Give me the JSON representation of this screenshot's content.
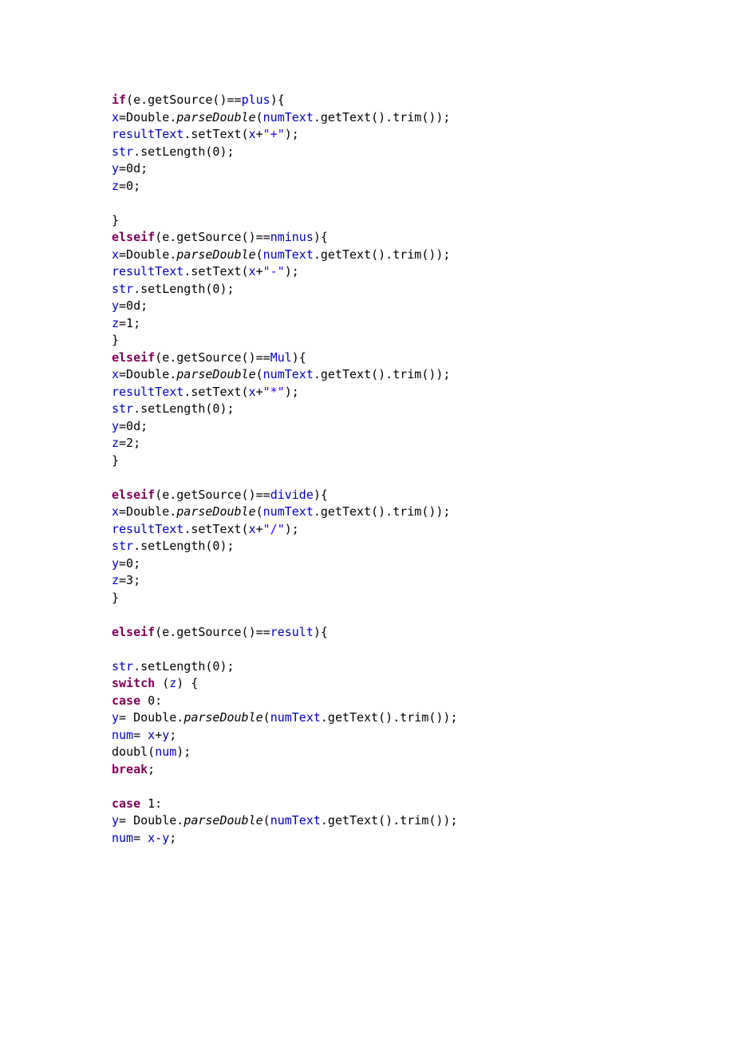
{
  "code": {
    "l01a": "if",
    "l01b": "(e.getSource()==",
    "l01c": "plus",
    "l01d": "){",
    "l02a": "x",
    "l02b": "=Double.",
    "l02c": "parseDouble",
    "l02d": "(",
    "l02e": "numText",
    "l02f": ".getText().trim());",
    "l03a": "resultText",
    "l03b": ".setText(",
    "l03c": "x",
    "l03d": "+",
    "l03e": "\"+\"",
    "l03f": ");",
    "l04a": "str",
    "l04b": ".setLength(0);",
    "l05a": "y",
    "l05b": "=0d;",
    "l06a": "z",
    "l06b": "=0;",
    "l07": "",
    "l08": "}",
    "l09a": "elseif",
    "l09b": "(e.getSource()==",
    "l09c": "nminus",
    "l09d": "){",
    "l10a": "x",
    "l10b": "=Double.",
    "l10c": "parseDouble",
    "l10d": "(",
    "l10e": "numText",
    "l10f": ".getText().trim());",
    "l11a": "resultText",
    "l11b": ".setText(",
    "l11c": "x",
    "l11d": "+",
    "l11e": "\"-\"",
    "l11f": ");",
    "l12a": "str",
    "l12b": ".setLength(0);",
    "l13a": "y",
    "l13b": "=0d;",
    "l14a": "z",
    "l14b": "=1;",
    "l15": "}",
    "l16a": "elseif",
    "l16b": "(e.getSource()==",
    "l16c": "Mul",
    "l16d": "){",
    "l17a": "x",
    "l17b": "=Double.",
    "l17c": "parseDouble",
    "l17d": "(",
    "l17e": "numText",
    "l17f": ".getText().trim());",
    "l18a": "resultText",
    "l18b": ".setText(",
    "l18c": "x",
    "l18d": "+",
    "l18e": "\"*\"",
    "l18f": ");",
    "l19a": "str",
    "l19b": ".setLength(0);",
    "l20a": "y",
    "l20b": "=0d;",
    "l21a": "z",
    "l21b": "=2;",
    "l22": "}",
    "l23": "",
    "l24a": "elseif",
    "l24b": "(e.getSource()==",
    "l24c": "divide",
    "l24d": "){",
    "l25a": "x",
    "l25b": "=Double.",
    "l25c": "parseDouble",
    "l25d": "(",
    "l25e": "numText",
    "l25f": ".getText().trim());",
    "l26a": "resultText",
    "l26b": ".setText(",
    "l26c": "x",
    "l26d": "+",
    "l26e": "\"/\"",
    "l26f": ");",
    "l27a": "str",
    "l27b": ".setLength(0);",
    "l28a": "y",
    "l28b": "=0;",
    "l29a": "z",
    "l29b": "=3;",
    "l30": "}",
    "l31": "",
    "l32a": "elseif",
    "l32b": "(e.getSource()==",
    "l32c": "result",
    "l32d": "){",
    "l33": "",
    "l34a": "str",
    "l34b": ".setLength(0);",
    "l35a": "switch",
    "l35b": " (",
    "l35c": "z",
    "l35d": ") {",
    "l36a": "case",
    "l36b": " 0:",
    "l37a": "y",
    "l37b": "= Double.",
    "l37c": "parseDouble",
    "l37d": "(",
    "l37e": "numText",
    "l37f": ".getText().trim());",
    "l38a": "num",
    "l38b": "= ",
    "l38c": "x",
    "l38d": "+",
    "l38e": "y",
    "l38f": ";",
    "l39a": "doubl(",
    "l39b": "num",
    "l39c": ");",
    "l40a": "break",
    "l40b": ";",
    "l41": "",
    "l42a": "case",
    "l42b": " 1:",
    "l43a": "y",
    "l43b": "= Double.",
    "l43c": "parseDouble",
    "l43d": "(",
    "l43e": "numText",
    "l43f": ".getText().trim());",
    "l44a": "num",
    "l44b": "= ",
    "l44c": "x",
    "l44d": "-",
    "l44e": "y",
    "l44f": ";"
  }
}
